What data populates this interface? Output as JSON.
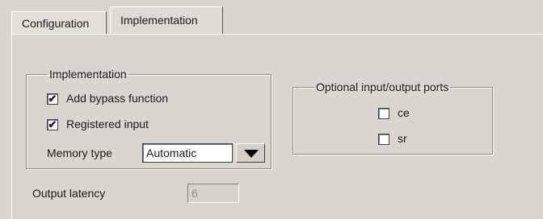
{
  "tabs": [
    {
      "label": "Configuration",
      "active": false
    },
    {
      "label": "Implementation",
      "active": true
    }
  ],
  "implementation_group": {
    "legend": "Implementation",
    "bypass": {
      "label": "Add bypass function",
      "checked": true,
      "mark": "✔"
    },
    "registered": {
      "label": "Registered input",
      "checked": true,
      "mark": "✔"
    },
    "memory_type": {
      "label": "Memory type",
      "value": "Automatic"
    }
  },
  "ports_group": {
    "legend": "Optional input/output ports",
    "ce": {
      "label": "ce",
      "checked": false
    },
    "sr": {
      "label": "sr",
      "checked": false
    }
  },
  "output_latency": {
    "label": "Output latency",
    "value": "6"
  },
  "colors": {
    "background": "#d9d6d0",
    "disabled_text": "#8c8c8c"
  },
  "icons": {
    "dropdown": "triangle-down-icon",
    "check": "checkmark-icon"
  }
}
